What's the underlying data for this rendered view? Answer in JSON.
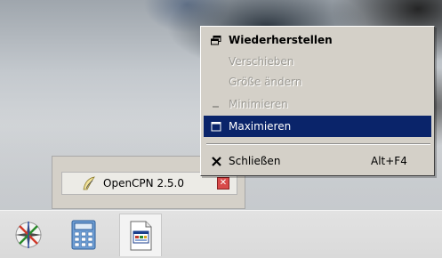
{
  "context_menu": {
    "items": [
      {
        "label": "Wiederherstellen",
        "icon": "restore-icon",
        "enabled": true,
        "default": true
      },
      {
        "label": "Verschieben",
        "enabled": false
      },
      {
        "label": "Größe ändern",
        "enabled": false
      },
      {
        "label": "Minimieren",
        "icon": "minimize-icon",
        "enabled": false
      },
      {
        "label": "Maximieren",
        "icon": "maximize-icon",
        "enabled": true,
        "highlighted": true
      },
      {
        "label": "Schließen",
        "icon": "close-icon",
        "shortcut": "Alt+F4",
        "enabled": true
      }
    ],
    "highlight_color": "#0a246a"
  },
  "thumbnail": {
    "title": "OpenCPN 2.5.0",
    "app_icon": "opencpn-icon",
    "close_icon": "close-icon"
  },
  "taskbar": {
    "items": [
      {
        "icon": "start-compass-icon"
      },
      {
        "icon": "calculator-icon"
      },
      {
        "icon": "opencpn-window-icon",
        "active": true
      }
    ]
  }
}
